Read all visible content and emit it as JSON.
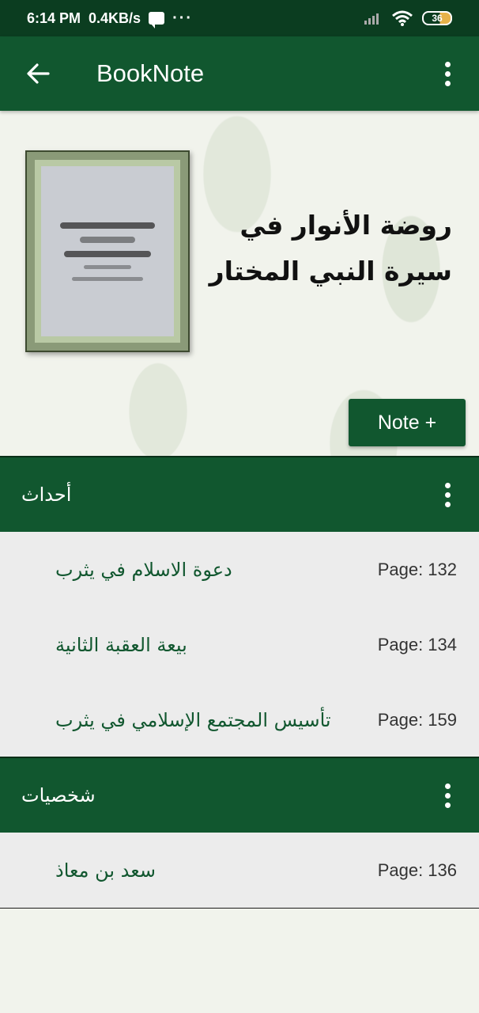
{
  "status_bar": {
    "time": "6:14 PM",
    "speed": "0.4KB/s",
    "more": "···",
    "battery": "36"
  },
  "app_bar": {
    "title": "BookNote"
  },
  "book": {
    "title_line1": "روضة الأنوار في",
    "title_line2": "سيرة النبي المختار",
    "note_button": "Note +"
  },
  "sections": [
    {
      "title": "أحداث",
      "items": [
        {
          "label": "دعوة الاسلام في يثرب",
          "page": "Page: 132"
        },
        {
          "label": "بيعة العقبة الثانية",
          "page": "Page: 134"
        },
        {
          "label": "تأسيس المجتمع الإسلامي في يثرب",
          "page": "Page: 159"
        }
      ]
    },
    {
      "title": "شخصيات",
      "items": [
        {
          "label": "سعد بن معاذ",
          "page": "Page: 136"
        }
      ]
    }
  ],
  "colors": {
    "primary": "#11572f",
    "status_bar": "#0b3d20",
    "list_bg": "#ececec"
  }
}
